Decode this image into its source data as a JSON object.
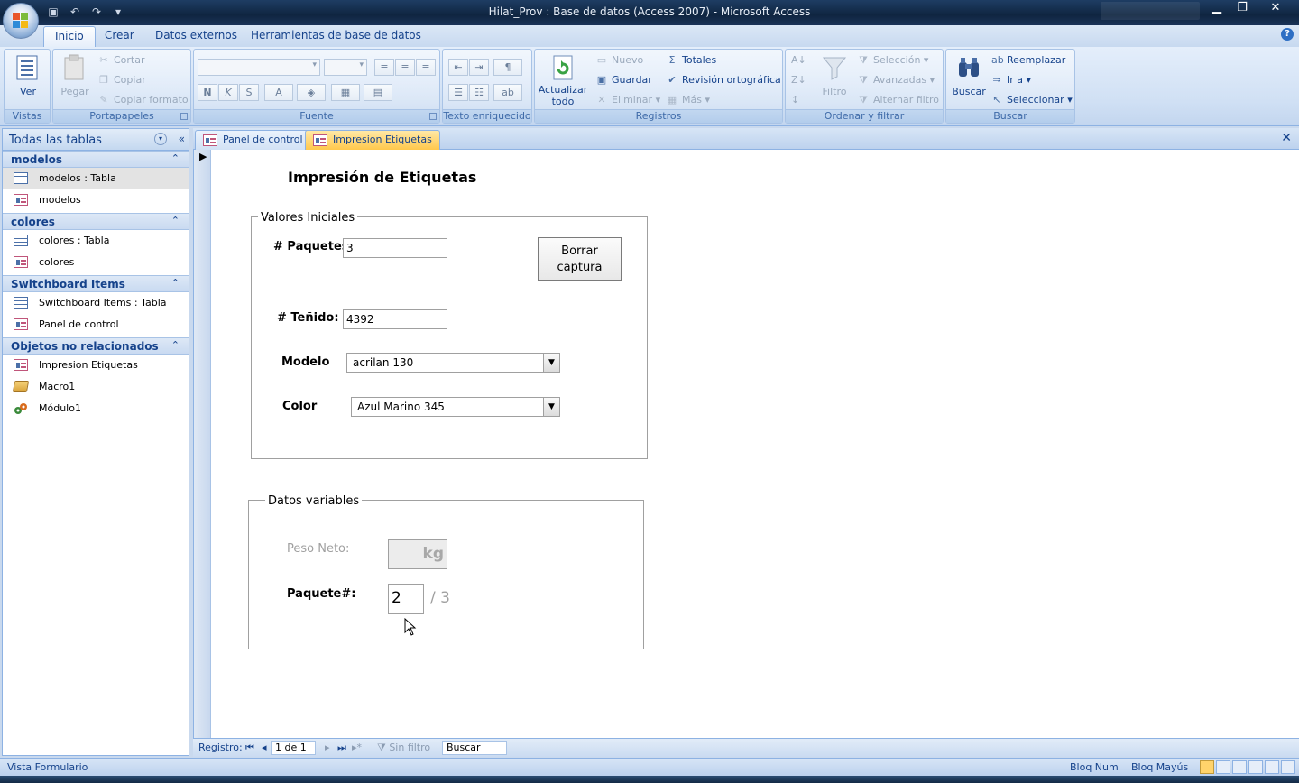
{
  "window": {
    "title": "Hilat_Prov : Base de datos (Access 2007) - Microsoft Access"
  },
  "ribbon": {
    "tabs": [
      "Inicio",
      "Crear",
      "Datos externos",
      "Herramientas de base de datos"
    ],
    "groups": {
      "vistas": {
        "label": "Vistas",
        "ver": "Ver"
      },
      "portapapeles": {
        "label": "Portapapeles",
        "pegar": "Pegar",
        "cortar": "Cortar",
        "copiar": "Copiar",
        "copiar_formato": "Copiar formato"
      },
      "fuente": {
        "label": "Fuente",
        "bold": "N",
        "italic": "K",
        "underline": "S",
        "font_color": "A"
      },
      "texto": {
        "label": "Texto enriquecido"
      },
      "registros": {
        "label": "Registros",
        "actualizar": "Actualizar",
        "todo": "todo",
        "nuevo": "Nuevo",
        "guardar": "Guardar",
        "eliminar": "Eliminar",
        "totales": "Totales",
        "revision": "Revisión ortográfica",
        "mas": "Más"
      },
      "ordenar": {
        "label": "Ordenar y filtrar",
        "filtro": "Filtro",
        "seleccion": "Selección",
        "avanzadas": "Avanzadas",
        "alternar": "Alternar filtro"
      },
      "buscar": {
        "label": "Buscar",
        "buscar": "Buscar",
        "reemplazar": "Reemplazar",
        "ir_a": "Ir a",
        "seleccionar": "Seleccionar"
      }
    }
  },
  "nav": {
    "header": "Todas las tablas",
    "groups": [
      {
        "name": "modelos",
        "items": [
          {
            "label": "modelos : Tabla",
            "kind": "table",
            "selected": true
          },
          {
            "label": "modelos",
            "kind": "form"
          }
        ]
      },
      {
        "name": "colores",
        "items": [
          {
            "label": "colores : Tabla",
            "kind": "table"
          },
          {
            "label": "colores",
            "kind": "form"
          }
        ]
      },
      {
        "name": "Switchboard Items",
        "items": [
          {
            "label": "Switchboard Items : Tabla",
            "kind": "table"
          },
          {
            "label": "Panel de control",
            "kind": "form"
          }
        ]
      },
      {
        "name": "Objetos no relacionados",
        "items": [
          {
            "label": "Impresion Etiquetas",
            "kind": "form"
          },
          {
            "label": "Macro1",
            "kind": "macro"
          },
          {
            "label": "Módulo1",
            "kind": "module"
          }
        ]
      }
    ]
  },
  "doc_tabs": [
    "Panel de control",
    "Impresion Etiquetas"
  ],
  "form": {
    "title": "Impresión de Etiquetas",
    "valores": {
      "legend": "Valores Iniciales",
      "paquetes_label": "# Paquetes:",
      "paquetes_value": "3",
      "borrar_line1": "Borrar",
      "borrar_line2": "captura",
      "tenido_label": "# Teñido:",
      "tenido_value": "4392",
      "modelo_label": "Modelo",
      "modelo_value": "acrilan 130",
      "color_label": "Color",
      "color_value": "Azul Marino 345"
    },
    "datos": {
      "legend": "Datos variables",
      "peso_label": "Peso Neto:",
      "peso_unit": "kg",
      "paquete_label": "Paquete#:",
      "paquete_value": "2",
      "paquete_total": "/ 3"
    }
  },
  "record_nav": {
    "label": "Registro:",
    "position": "1 de 1",
    "filter": "Sin filtro",
    "search": "Buscar"
  },
  "status": {
    "view": "Vista Formulario",
    "num": "Bloq Num",
    "caps": "Bloq Mayús"
  },
  "colors": {
    "active_tab": "#ffc84c",
    "ribbon_text": "#15428b"
  }
}
